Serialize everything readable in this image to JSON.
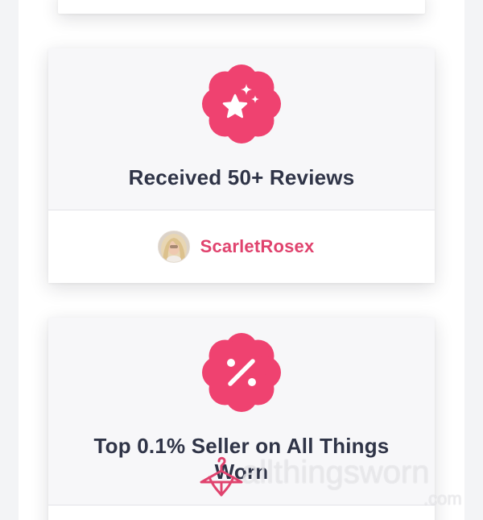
{
  "colors": {
    "accent": "#e0436e",
    "badge": "#ef4270",
    "title": "#2f3447",
    "card_top": "#f7f7f9",
    "page_bg": "#f3f4f6"
  },
  "cards": [
    {
      "badge_icon": "star-sparkle-icon",
      "title": "Received 50+ Reviews",
      "username": "ScarletRosex"
    },
    {
      "badge_icon": "percent-icon",
      "title": "Top 0.1% Seller on All Things Worn"
    }
  ],
  "watermark": {
    "logo_icon": "hanger-icon",
    "text": "allthingsworn",
    "suffix": ".com"
  }
}
